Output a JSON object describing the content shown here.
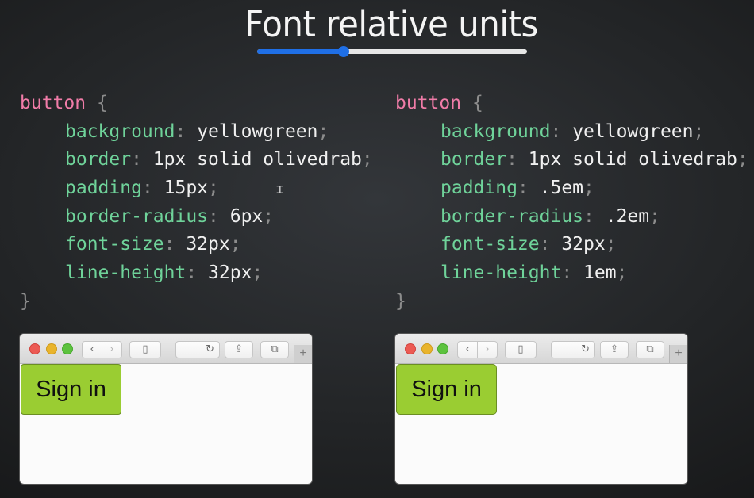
{
  "slide": {
    "title": "Font relative units",
    "slider": {
      "progress": 0.32,
      "accent": "#1f6fe6"
    }
  },
  "left": {
    "selector": "button",
    "open_brace": "{",
    "close_brace": "}",
    "declarations": [
      {
        "prop": "background",
        "value": "yellowgreen"
      },
      {
        "prop": "border",
        "value": "1px solid olivedrab"
      },
      {
        "prop": "padding",
        "value": "15px"
      },
      {
        "prop": "border-radius",
        "value": "6px"
      },
      {
        "prop": "font-size",
        "value": "32px"
      },
      {
        "prop": "line-height",
        "value": "32px"
      }
    ],
    "preview": {
      "button_label": "Sign in"
    }
  },
  "right": {
    "selector": "button",
    "open_brace": "{",
    "close_brace": "}",
    "declarations": [
      {
        "prop": "background",
        "value": "yellowgreen"
      },
      {
        "prop": "border",
        "value": "1px solid olivedrab"
      },
      {
        "prop": "padding",
        "value": ".5em"
      },
      {
        "prop": "border-radius",
        "value": ".2em"
      },
      {
        "prop": "font-size",
        "value": "32px"
      },
      {
        "prop": "line-height",
        "value": "1em"
      }
    ],
    "preview": {
      "button_label": "Sign in"
    }
  },
  "colors": {
    "selector": "#f07ca8",
    "property": "#6fd39a",
    "button_bg": "#9acd32",
    "button_border": "#6b8e23"
  },
  "icons": [
    "back-icon",
    "forward-icon",
    "sidebar-icon",
    "reload-icon",
    "share-icon",
    "tabs-icon",
    "new-tab-icon"
  ]
}
